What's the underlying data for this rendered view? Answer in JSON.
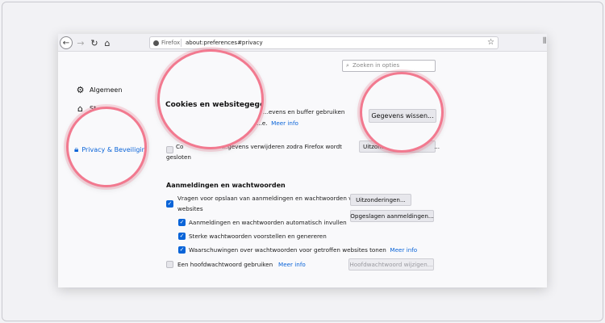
{
  "toolbar": {
    "identity_label": "Firefox",
    "url": "about:preferences#privacy"
  },
  "search": {
    "placeholder": "Zoeken in opties"
  },
  "sidebar": {
    "items": [
      {
        "label": "Algemeen",
        "icon": "gear-icon"
      },
      {
        "label": "St...",
        "icon": "home-icon"
      },
      {
        "label": "Privacy & Beveiliging",
        "icon": "lock-icon"
      }
    ]
  },
  "cookies": {
    "title": "Cookies en websitegegevens",
    "line1": "...evens en buffer gebruiken",
    "line2": "...e.",
    "more_info": "Meer info",
    "clear_button": "Gegevens wissen...",
    "delete_line1_start": "Co",
    "delete_line1_end": "...gevens verwijderen zodra Firefox wordt",
    "delete_line2": "gesloten",
    "exceptions_button": "Uitzond...",
    "exceptions_suffix": "..."
  },
  "logins": {
    "title": "Aanmeldingen en wachtwoorden",
    "ask_save_line1": "Vragen voor opslaan van aanmeldingen en wachtwoorden voor",
    "ask_save_line2": "websites",
    "autofill": "Aanmeldingen en wachtwoorden automatisch invullen",
    "suggest_strong": "Sterke wachtwoorden voorstellen en genereren",
    "breach_alerts": "Waarschuwingen over wachtwoorden voor getroffen websites tonen",
    "breach_more_info": "Meer info",
    "exceptions_button": "Uitzonderingen...",
    "saved_logins_button": "Opgeslagen aanmeldingen...",
    "master_password": "Een hoofdwachtwoord gebruiken",
    "master_more_info": "Meer info",
    "change_master_button": "Hoofdwachtwoord wijzigen..."
  },
  "colors": {
    "accent": "#0a64d8",
    "highlight": "#f2798f"
  }
}
